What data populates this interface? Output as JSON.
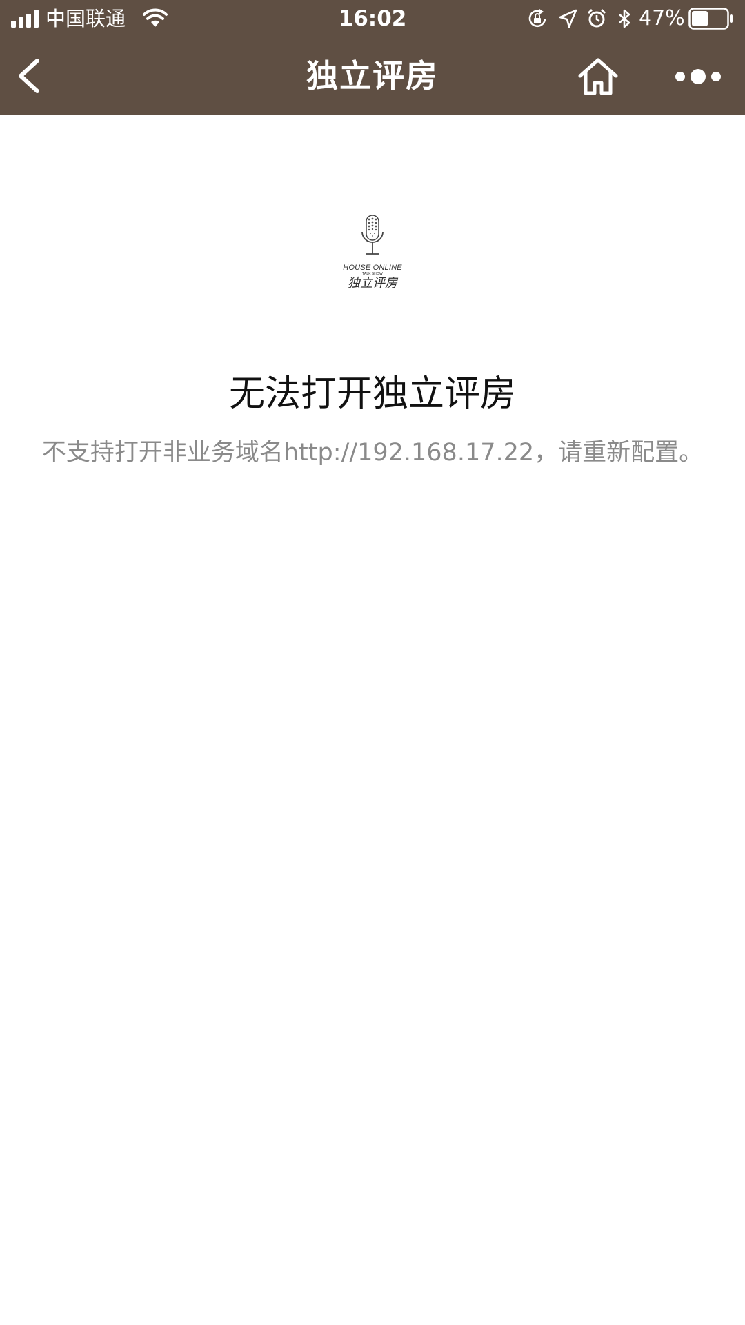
{
  "status_bar": {
    "carrier": "中国联通",
    "time": "16:02",
    "battery_percent": "47%",
    "battery_level": 0.47,
    "icons": [
      "signal-icon",
      "wifi-icon",
      "rotation-lock-icon",
      "location-icon",
      "alarm-icon",
      "bluetooth-icon",
      "battery-icon"
    ]
  },
  "nav": {
    "title": "独立评房",
    "icons": [
      "back-chevron-icon",
      "home-icon",
      "more-dots-icon"
    ]
  },
  "logo": {
    "en": "HOUSE ONLINE",
    "sub": "TALK SHOW",
    "cn": "独立评房"
  },
  "error": {
    "title": "无法打开独立评房",
    "message": "不支持打开非业务域名http://192.168.17.22，请重新配置。"
  },
  "colors": {
    "bar": "#5f4f43",
    "title_text": "#111111",
    "message_text": "#8a8a8a"
  }
}
